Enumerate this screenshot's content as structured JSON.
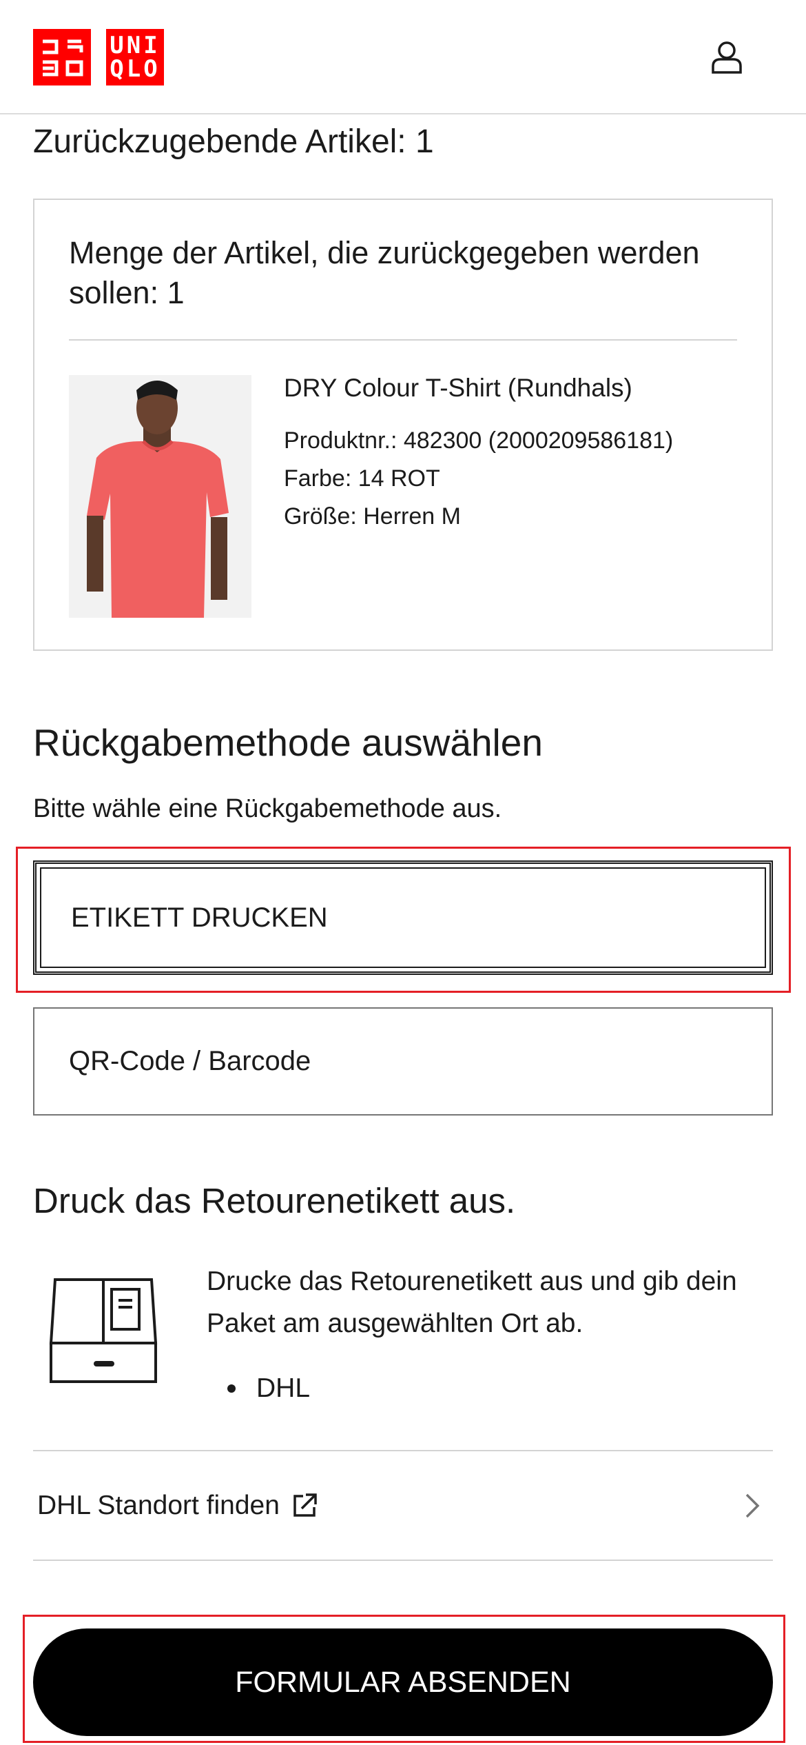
{
  "brand": {
    "logo_left": "ユニクロ",
    "logo_right_line1": "UNI",
    "logo_right_line2": "QLO",
    "color": "#ff0000"
  },
  "header": {
    "account_icon": "person-outline-icon"
  },
  "items_section": {
    "title": "Zurückzugebende Artikel: 1",
    "card": {
      "quantity_text": "Menge der Artikel, die zurückgegeben werden sollen: 1",
      "product": {
        "name": "DRY Colour T-Shirt (Rundhals)",
        "product_number": "Produktnr.: 482300 (2000209586181)",
        "color": "Farbe: 14 ROT",
        "size": "Größe: Herren M",
        "image_shirt_color": "#f06060"
      }
    }
  },
  "return_method": {
    "title": "Rückgabemethode auswählen",
    "subtitle": "Bitte wähle eine Rückgabemethode aus.",
    "options": [
      {
        "label": "ETIKETT DRUCKEN",
        "selected": true
      },
      {
        "label": "QR-Code / Barcode",
        "selected": false
      }
    ]
  },
  "print_label": {
    "title": "Druck das Retourenetikett aus.",
    "description": "Drucke das Retourenetikett aus und gib dein Paket am ausgewählten Ort ab.",
    "carriers": [
      "DHL"
    ],
    "icon": "package-label-icon"
  },
  "dhl_finder": {
    "label": "DHL Standort finden",
    "icon": "external-link-icon",
    "chevron": "chevron-right-icon"
  },
  "submit": {
    "label": "FORMULAR ABSENDEN"
  },
  "colors": {
    "highlight": "#e41f26",
    "border": "#d3d3d3",
    "text": "#1b1b1b"
  }
}
